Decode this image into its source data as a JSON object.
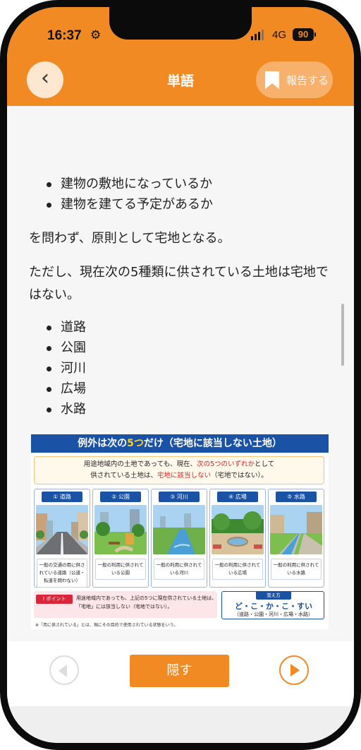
{
  "status": {
    "time": "16:37",
    "network": "4G",
    "battery": "90"
  },
  "header": {
    "title": "単語",
    "report_label": "報告する"
  },
  "content": {
    "bullets_top": [
      "建物の敷地になっているか",
      "建物を建てる予定があるか"
    ],
    "para1": "を問わず、原則として宅地となる。",
    "para2": "ただし、現在次の5種類に供されている土地は宅地ではない。",
    "bullets_list": [
      "道路",
      "公園",
      "河川",
      "広場",
      "水路"
    ]
  },
  "infographic": {
    "title_pre": "例外は次の",
    "title_num": "5つ",
    "title_post": "だけ（宅地に該当しない土地）",
    "intro_line1_a": "用途地域内の土地であっても、現在、",
    "intro_line1_red": "次の5つのいずれか",
    "intro_line1_b": "として",
    "intro_line2_a": "供されている土地は、",
    "intro_line2_red": "宅地に該当しない",
    "intro_line2_b": "（宅地ではない）。",
    "cards": [
      {
        "tag": "① 道路",
        "caption": "一般の交通の用に供されている道路（公道・私道を問わない）"
      },
      {
        "tag": "② 公園",
        "caption": "一般の利用に供されている公園"
      },
      {
        "tag": "③ 河川",
        "caption": "一般の利用に供されている河川"
      },
      {
        "tag": "④ 広場",
        "caption": "一般の利用に供されている広場"
      },
      {
        "tag": "⑤ 水路",
        "caption": "一般の利用に供されている水路"
      }
    ],
    "point_tag": "ポイント",
    "point_text": "用途地域内であっても、上記の5つに現在供されている土地は、「宅地」には該当しない（宅地ではない）。",
    "memo_title": "覚え方",
    "memo_main": "ど・こ・か・こ・すい",
    "memo_sub": "（道路・公園・河川・広場・水路）",
    "footnote": "※「用に供されている」とは、現にその目的で使用されている状態をいう。"
  },
  "footer": {
    "hide_label": "隠す"
  },
  "colors": {
    "accent": "#f28a24",
    "navy": "#1a52a6",
    "highlight": "#e02020"
  }
}
